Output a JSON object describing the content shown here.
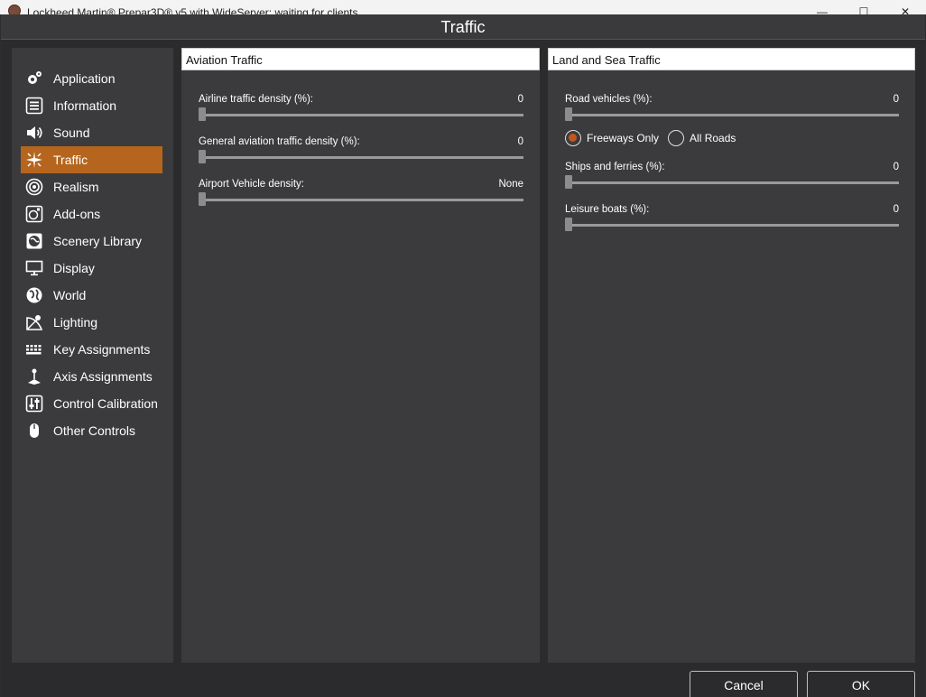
{
  "window": {
    "title": "Lockheed Martin® Prepar3D® v5 with WideServer: waiting for clients",
    "minimize": "—",
    "maximize": "☐",
    "close": "✕"
  },
  "dialog": {
    "title": "Traffic"
  },
  "sidebar": {
    "items": [
      {
        "label": "Application",
        "icon": "gear-icon",
        "active": false
      },
      {
        "label": "Information",
        "icon": "list-icon",
        "active": false
      },
      {
        "label": "Sound",
        "icon": "speaker-icon",
        "active": false
      },
      {
        "label": "Traffic",
        "icon": "traffic-icon",
        "active": true
      },
      {
        "label": "Realism",
        "icon": "realism-icon",
        "active": false
      },
      {
        "label": "Add-ons",
        "icon": "addons-icon",
        "active": false
      },
      {
        "label": "Scenery Library",
        "icon": "globe-icon",
        "active": false
      },
      {
        "label": "Display",
        "icon": "monitor-icon",
        "active": false
      },
      {
        "label": "World",
        "icon": "world-icon",
        "active": false
      },
      {
        "label": "Lighting",
        "icon": "lighting-icon",
        "active": false
      },
      {
        "label": "Key Assignments",
        "icon": "keyboard-icon",
        "active": false
      },
      {
        "label": "Axis Assignments",
        "icon": "joystick-icon",
        "active": false
      },
      {
        "label": "Control Calibration",
        "icon": "calibration-icon",
        "active": false
      },
      {
        "label": "Other Controls",
        "icon": "mouse-icon",
        "active": false
      }
    ]
  },
  "aviation": {
    "header": "Aviation Traffic",
    "settings": [
      {
        "label": "Airline traffic density (%):",
        "value": "0",
        "level": 0
      },
      {
        "label": "General aviation traffic density (%):",
        "value": "0",
        "level": 0
      },
      {
        "label": "Airport Vehicle density:",
        "value": "None",
        "level": 0
      }
    ]
  },
  "land": {
    "header": "Land and Sea Traffic",
    "road": {
      "label": "Road vehicles (%):",
      "value": "0",
      "level": 0
    },
    "radios": [
      {
        "label": "Freeways Only",
        "checked": true
      },
      {
        "label": "All Roads",
        "checked": false
      }
    ],
    "ships": {
      "label": "Ships and ferries (%):",
      "value": "0",
      "level": 0
    },
    "leisure": {
      "label": "Leisure boats (%):",
      "value": "0",
      "level": 0
    }
  },
  "footer": {
    "cancel": "Cancel",
    "ok": "OK"
  },
  "colors": {
    "accent": "#b5651d",
    "radio_checked": "#c0571f",
    "panel_bg": "#3b3b3d"
  }
}
